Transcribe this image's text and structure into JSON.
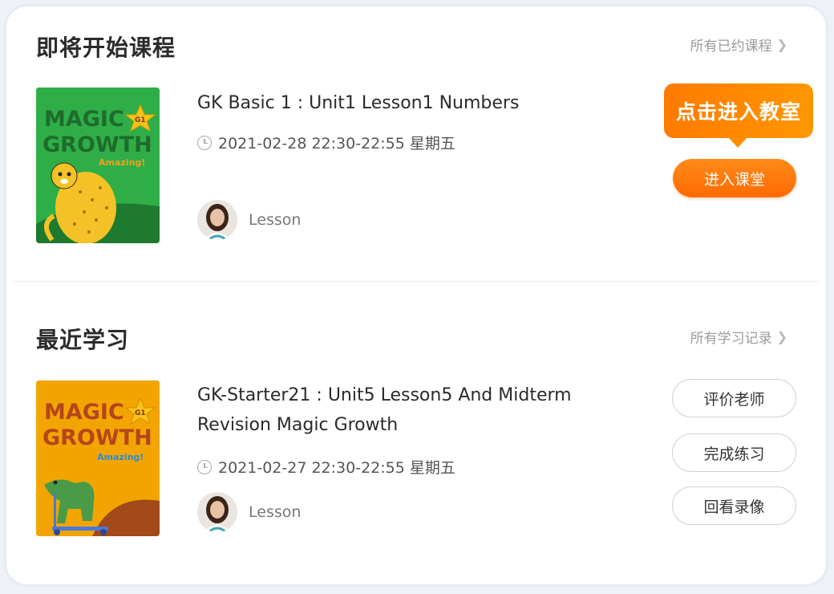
{
  "upcoming": {
    "title": "即将开始课程",
    "see_all": "所有已约课程",
    "course": {
      "cover_text_line1": "MAGIC",
      "cover_text_line2": "GROWTH",
      "cover_badge": "G1",
      "cover_tagline": "Amazing!",
      "title": "GK Basic  1 : Unit1 Lesson1 Numbers",
      "time": "2021-02-28 22:30-22:55 星期五",
      "teacher_label": "Lesson",
      "tooltip": "点击进入教室",
      "enter_button": "进入课堂"
    }
  },
  "recent": {
    "title": "最近学习",
    "see_all": "所有学习记录",
    "course": {
      "cover_text_line1": "MAGIC",
      "cover_text_line2": "GROWTH",
      "cover_badge": "G1",
      "cover_tagline": "Amazing!",
      "title_line1": "GK-Starter21 : Unit5 Lesson5 And Midterm",
      "title_line2": "Revision Magic Growth",
      "time": "2021-02-27 22:30-22:55 星期五",
      "teacher_label": "Lesson",
      "buttons": [
        "评价老师",
        "完成练习",
        "回看录像"
      ]
    }
  },
  "colors": {
    "accent": "#ff7a00",
    "cover_green": "#2fae48",
    "cover_yellow": "#f2a500"
  }
}
